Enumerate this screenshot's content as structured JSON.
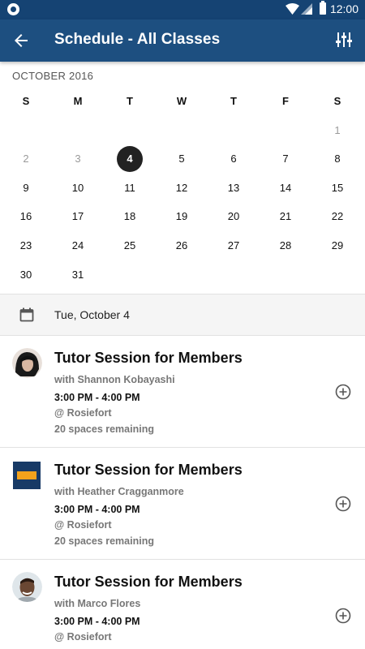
{
  "status_bar": {
    "time": "12:00"
  },
  "app_bar": {
    "title": "Schedule - All Classes"
  },
  "calendar": {
    "month_label": "OCTOBER 2016",
    "weekdays": [
      "S",
      "M",
      "T",
      "W",
      "T",
      "F",
      "S"
    ],
    "weeks": [
      [
        "",
        "",
        "",
        "",
        "",
        "",
        "1"
      ],
      [
        "2",
        "3",
        "4",
        "5",
        "6",
        "7",
        "8"
      ],
      [
        "9",
        "10",
        "11",
        "12",
        "13",
        "14",
        "15"
      ],
      [
        "16",
        "17",
        "18",
        "19",
        "20",
        "21",
        "22"
      ],
      [
        "23",
        "24",
        "25",
        "26",
        "27",
        "28",
        "29"
      ],
      [
        "30",
        "31",
        "",
        "",
        "",
        "",
        ""
      ]
    ],
    "selected_day": "4",
    "muted_days": [
      "1",
      "2",
      "3"
    ]
  },
  "selected_date": {
    "label": "Tue, October 4"
  },
  "sessions": [
    {
      "title": "Tutor Session for Members",
      "teacher": "with Shannon Kobayashi",
      "time": "3:00 PM - 4:00 PM",
      "location": "@ Rosiefort",
      "spaces": "20 spaces remaining",
      "avatar": "woman-photo"
    },
    {
      "title": "Tutor Session for Members",
      "teacher": "with Heather Cragganmore",
      "time": "3:00 PM - 4:00 PM",
      "location": "@ Rosiefort",
      "spaces": "20 spaces remaining",
      "avatar": "logo-image"
    },
    {
      "title": "Tutor Session for Members",
      "teacher": "with Marco Flores",
      "time": "3:00 PM - 4:00 PM",
      "location": "@ Rosiefort",
      "spaces": "",
      "avatar": "man-photo"
    }
  ],
  "colors": {
    "app_bar": "#1d4f80",
    "status_bar": "#154373",
    "selected_day": "#222222"
  }
}
